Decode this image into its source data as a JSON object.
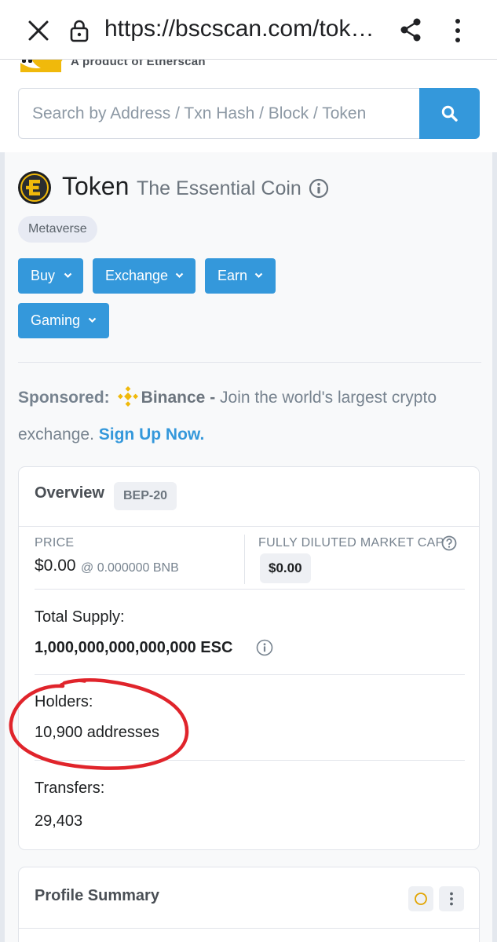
{
  "browser": {
    "url": "https://bscscan.com/tok…",
    "close_icon": "close-icon",
    "lock_icon": "lock-icon",
    "share_icon": "share-icon",
    "menu_icon": "more-vert-icon"
  },
  "header": {
    "tagline": "A product of Etherscan"
  },
  "search": {
    "placeholder": "Search by Address / Txn Hash / Block / Token",
    "button_icon": "search-icon"
  },
  "token": {
    "name": "Token",
    "full_name": "The Essential Coin",
    "tag": "Metaverse"
  },
  "categories": [
    "Buy",
    "Exchange",
    "Earn",
    "Gaming"
  ],
  "sponsored": {
    "lead": "Sponsored:",
    "brand": "Binance -",
    "text": " Join the world's largest crypto exchange. ",
    "cta": "Sign Up Now."
  },
  "overview": {
    "title": "Overview",
    "badge": "BEP-20",
    "price_label": "PRICE",
    "price_value": "$0.00",
    "price_bnb": "@ 0.000000 BNB",
    "mcap_label": "FULLY DILUTED MARKET CAP",
    "mcap_value": "$0.00",
    "supply_label": "Total Supply:",
    "supply_value": "1,000,000,000,000,000 ESC",
    "holders_label": "Holders:",
    "holders_value": "10,900 addresses",
    "transfers_label": "Transfers:",
    "transfers_value": "29,403"
  },
  "profile": {
    "title": "Profile Summary"
  },
  "colors": {
    "primary": "#3498db",
    "annotation": "#e0242b",
    "binance": "#f0b90b"
  }
}
